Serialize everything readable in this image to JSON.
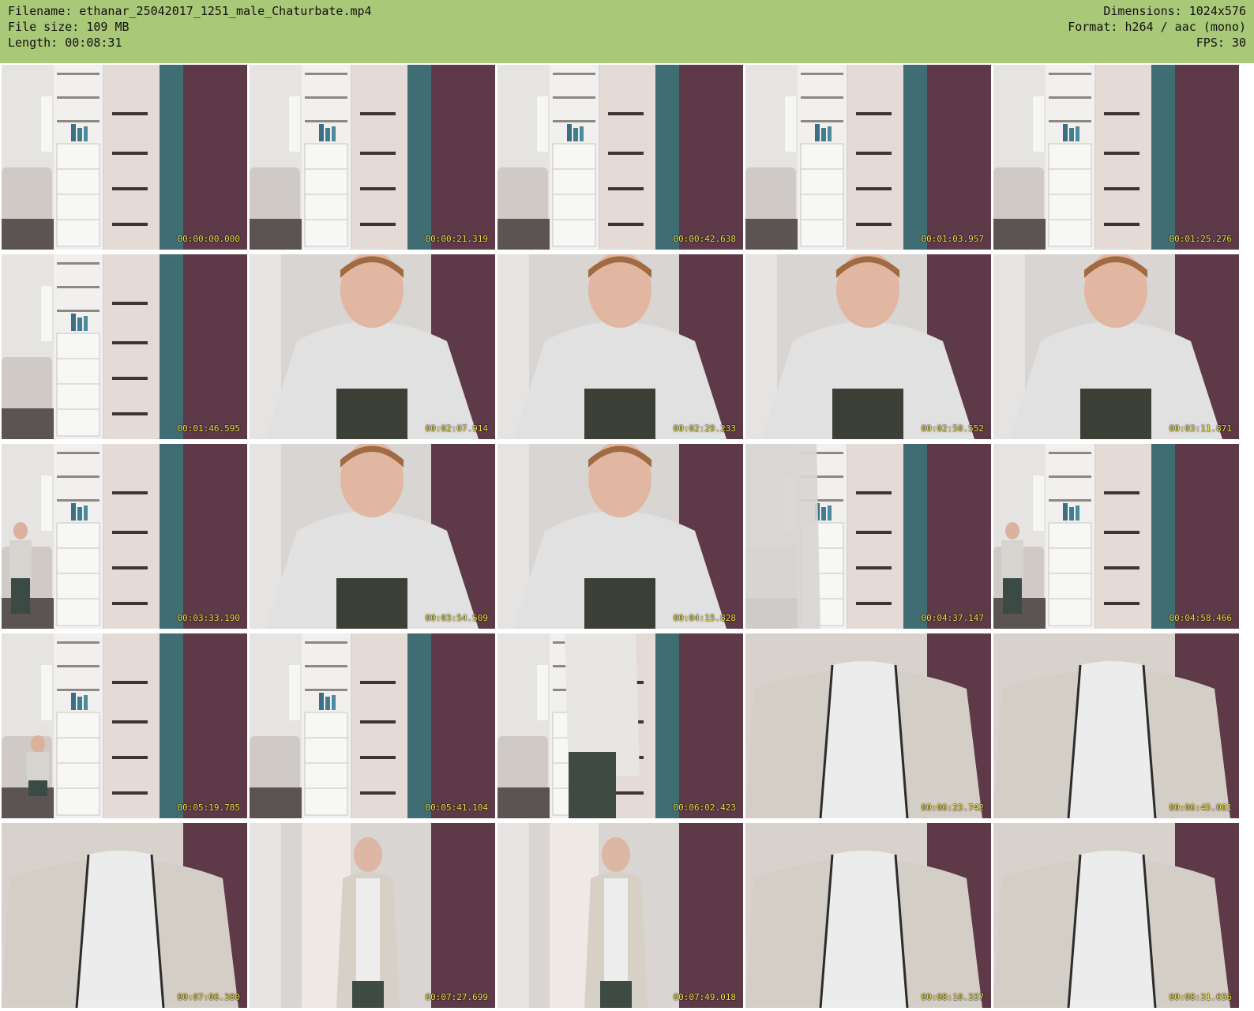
{
  "header": {
    "filename": "Filename: ethanar_25042017_1251_male_Chaturbate.mp4",
    "filesize": "File size: 109 MB",
    "length": "Length: 00:08:31",
    "dimensions": "Dimensions: 1024x576",
    "format": "Format: h264 / aac (mono)",
    "fps": "FPS: 30",
    "background_color": "#a9c878"
  },
  "timestamp_color": "#f2e045",
  "thumbnails": [
    {
      "time": "00:00:00.000",
      "scene": "room"
    },
    {
      "time": "00:00:21.319",
      "scene": "room"
    },
    {
      "time": "00:00:42.638",
      "scene": "room"
    },
    {
      "time": "00:01:03.957",
      "scene": "room"
    },
    {
      "time": "00:01:25.276",
      "scene": "room"
    },
    {
      "time": "00:01:46.595",
      "scene": "room"
    },
    {
      "time": "00:02:07.914",
      "scene": "person-leaning"
    },
    {
      "time": "00:02:29.233",
      "scene": "person-leaning"
    },
    {
      "time": "00:02:50.552",
      "scene": "person-leaning"
    },
    {
      "time": "00:03:11.871",
      "scene": "person-leaning"
    },
    {
      "time": "00:03:33.190",
      "scene": "room-person-seated"
    },
    {
      "time": "00:03:54.509",
      "scene": "person-leaning"
    },
    {
      "time": "00:04:15.828",
      "scene": "person-leaning"
    },
    {
      "time": "00:04:37.147",
      "scene": "room-motion-blur"
    },
    {
      "time": "00:04:58.466",
      "scene": "room-person-seated"
    },
    {
      "time": "00:05:19.785",
      "scene": "room-person-crouching"
    },
    {
      "time": "00:05:41.104",
      "scene": "room"
    },
    {
      "time": "00:06:02.423",
      "scene": "room-person-standing"
    },
    {
      "time": "00:06:23.742",
      "scene": "closeup-jacket"
    },
    {
      "time": "00:06:45.061",
      "scene": "closeup-jacket"
    },
    {
      "time": "00:07:06.380",
      "scene": "closeup-jacket"
    },
    {
      "time": "00:07:27.699",
      "scene": "person-on-phone"
    },
    {
      "time": "00:07:49.018",
      "scene": "person-on-phone"
    },
    {
      "time": "00:08:10.337",
      "scene": "closeup-jacket"
    },
    {
      "time": "00:08:31.656",
      "scene": "closeup-jacket"
    }
  ]
}
